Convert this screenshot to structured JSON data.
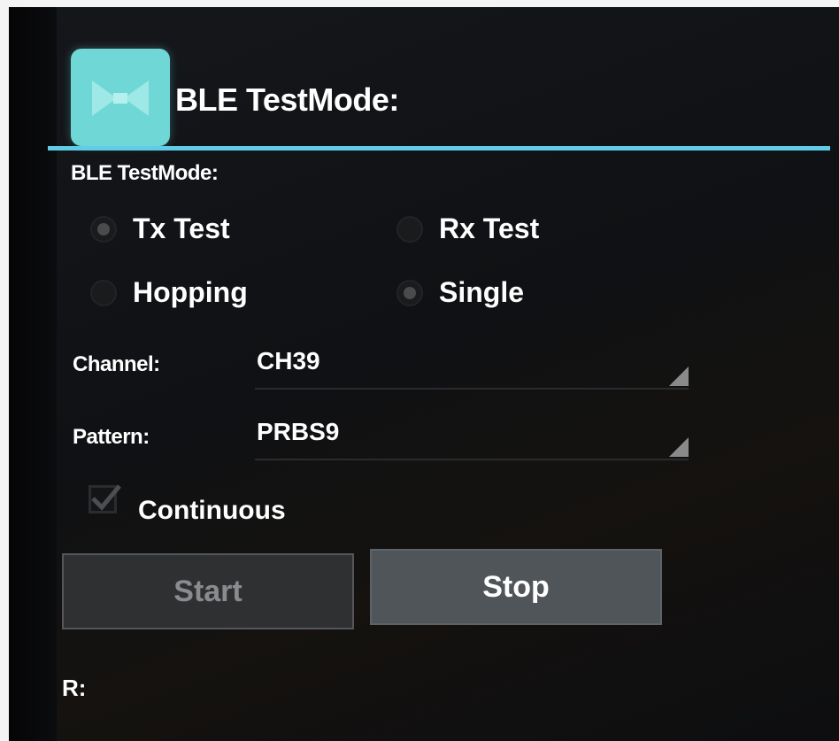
{
  "header": {
    "app_title": "BLE TestMode:",
    "icon": "app-icon",
    "accent_color": "#5fcde7",
    "icon_color": "#6fd8d6"
  },
  "section": {
    "label": "BLE TestMode:"
  },
  "mode": {
    "tx_label": "Tx Test",
    "rx_label": "Rx Test",
    "selected": "Tx Test"
  },
  "hop": {
    "hopping_label": "Hopping",
    "single_label": "Single",
    "selected": "Single"
  },
  "channel": {
    "label": "Channel:",
    "value": "CH39"
  },
  "pattern": {
    "label": "Pattern:",
    "value": "PRBS9"
  },
  "continuous": {
    "label": "Continuous",
    "checked": true
  },
  "buttons": {
    "start_label": "Start",
    "start_enabled": false,
    "stop_label": "Stop",
    "stop_enabled": true
  },
  "result": {
    "label": "R:"
  }
}
